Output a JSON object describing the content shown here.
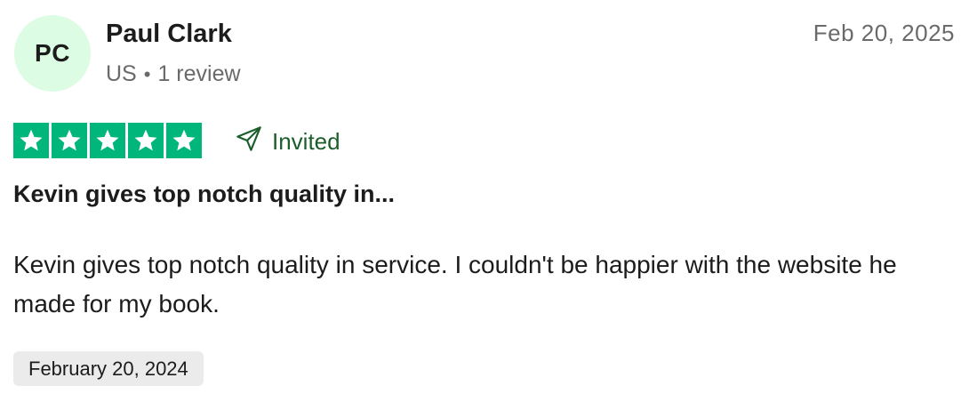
{
  "reviewer": {
    "initials": "PC",
    "name": "Paul Clark",
    "country": "US",
    "separator": "•",
    "review_count": "1 review",
    "avatar_color": "#dcfce3"
  },
  "review": {
    "posted_date": "Feb 20, 2025",
    "rating": 5,
    "rating_max": 5,
    "star_color": "#00b67a",
    "invited_label": "Invited",
    "invited_icon": "send-icon",
    "title": "Kevin gives top notch quality in...",
    "body": "Kevin gives top notch quality in service. I couldn't be happier with the website he made for my book.",
    "experience_date": "February 20, 2024"
  }
}
